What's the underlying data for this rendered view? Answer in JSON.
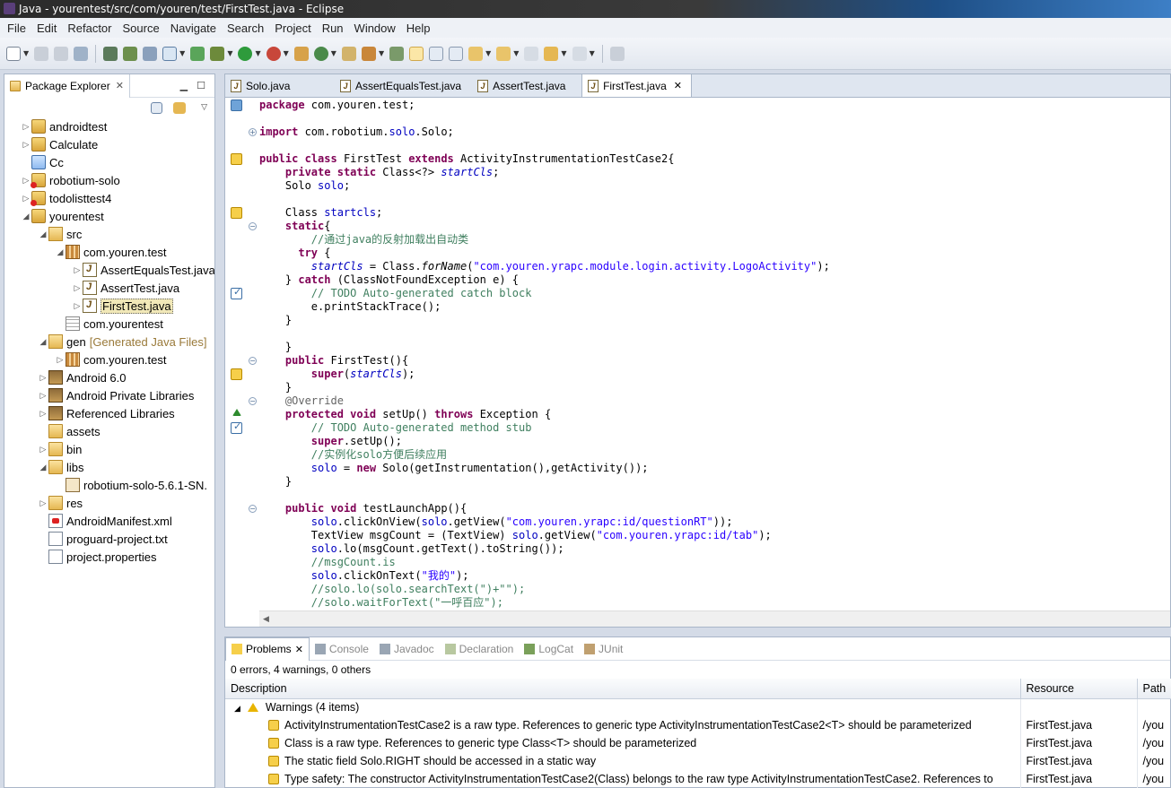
{
  "window": {
    "title": "Java - yourentest/src/com/youren/test/FirstTest.java - Eclipse"
  },
  "menu": [
    "File",
    "Edit",
    "Refactor",
    "Source",
    "Navigate",
    "Search",
    "Project",
    "Run",
    "Window",
    "Help"
  ],
  "package_explorer": {
    "tab_label": "Package Explorer",
    "items": [
      {
        "label": "androidtest",
        "suffix": "",
        "indent": 0,
        "arrow": "right",
        "icon": "project-icon"
      },
      {
        "label": "Calculate",
        "suffix": "",
        "indent": 0,
        "arrow": "right",
        "icon": "project-icon"
      },
      {
        "label": "Cc",
        "suffix": "",
        "indent": 0,
        "arrow": "",
        "icon": "folder-project-icon"
      },
      {
        "label": "robotium-solo",
        "suffix": "",
        "indent": 0,
        "arrow": "right",
        "icon": "project-error-icon"
      },
      {
        "label": "todolisttest4",
        "suffix": "",
        "indent": 0,
        "arrow": "right",
        "icon": "project-error-icon"
      },
      {
        "label": "yourentest",
        "suffix": "",
        "indent": 0,
        "arrow": "down",
        "icon": "project-icon"
      },
      {
        "label": "src",
        "suffix": "",
        "indent": 1,
        "arrow": "down",
        "icon": "source-folder-icon"
      },
      {
        "label": "com.youren.test",
        "suffix": "",
        "indent": 2,
        "arrow": "down",
        "icon": "package-icon"
      },
      {
        "label": "AssertEqualsTest.java",
        "suffix": "",
        "indent": 3,
        "arrow": "right",
        "icon": "java-file-icon"
      },
      {
        "label": "AssertTest.java",
        "suffix": "",
        "indent": 3,
        "arrow": "right",
        "icon": "java-file-icon"
      },
      {
        "label": "FirstTest.java",
        "suffix": "",
        "indent": 3,
        "arrow": "right",
        "icon": "java-file-icon",
        "selected": true
      },
      {
        "label": "com.yourentest",
        "suffix": "",
        "indent": 2,
        "arrow": "",
        "icon": "empty-package-icon"
      },
      {
        "label": "gen",
        "suffix": "[Generated Java Files]",
        "indent": 1,
        "arrow": "down",
        "icon": "source-folder-icon"
      },
      {
        "label": "com.youren.test",
        "suffix": "",
        "indent": 2,
        "arrow": "right",
        "icon": "package-icon"
      },
      {
        "label": "Android 6.0",
        "suffix": "",
        "indent": 1,
        "arrow": "right",
        "icon": "library-icon"
      },
      {
        "label": "Android Private Libraries",
        "suffix": "",
        "indent": 1,
        "arrow": "right",
        "icon": "library-icon"
      },
      {
        "label": "Referenced Libraries",
        "suffix": "",
        "indent": 1,
        "arrow": "right",
        "icon": "library-icon"
      },
      {
        "label": "assets",
        "suffix": "",
        "indent": 1,
        "arrow": "",
        "icon": "folder-icon"
      },
      {
        "label": "bin",
        "suffix": "",
        "indent": 1,
        "arrow": "right",
        "icon": "folder-icon"
      },
      {
        "label": "libs",
        "suffix": "",
        "indent": 1,
        "arrow": "down",
        "icon": "folder-icon"
      },
      {
        "label": "robotium-solo-5.6.1-SN.",
        "suffix": "",
        "indent": 2,
        "arrow": "",
        "icon": "jar-icon"
      },
      {
        "label": "res",
        "suffix": "",
        "indent": 1,
        "arrow": "right",
        "icon": "folder-icon"
      },
      {
        "label": "AndroidManifest.xml",
        "suffix": "",
        "indent": 1,
        "arrow": "",
        "icon": "xml-file-icon"
      },
      {
        "label": "proguard-project.txt",
        "suffix": "",
        "indent": 1,
        "arrow": "",
        "icon": "text-file-icon"
      },
      {
        "label": "project.properties",
        "suffix": "",
        "indent": 1,
        "arrow": "",
        "icon": "text-file-icon"
      }
    ]
  },
  "editor": {
    "tabs": [
      {
        "label": "Solo.java",
        "active": false
      },
      {
        "label": "AssertEqualsTest.java",
        "active": false
      },
      {
        "label": "AssertTest.java",
        "active": false
      },
      {
        "label": "FirstTest.java",
        "active": true
      }
    ],
    "lines": [
      "package com.youren.test;",
      "",
      "import com.robotium.solo.Solo;",
      "",
      "public class FirstTest extends ActivityInstrumentationTestCase2{",
      "    private static Class<?> startCls;",
      "    Solo solo;",
      "",
      "    Class startcls;",
      "    static{",
      "        //通过java的反射加载出自动类",
      "      try {",
      "        startCls = Class.forName(\"com.youren.yrapc.module.login.activity.LogoActivity\");",
      "    } catch (ClassNotFoundException e) {",
      "        // TODO Auto-generated catch block",
      "        e.printStackTrace();",
      "    }",
      "",
      "    }",
      "    public FirstTest(){",
      "        super(startCls);",
      "    }",
      "    @Override",
      "    protected void setUp() throws Exception {",
      "        // TODO Auto-generated method stub",
      "        super.setUp();",
      "        //实例化solo方便后续应用",
      "        solo = new Solo(getInstrumentation(),getActivity());",
      "    }",
      "",
      "    public void testLaunchApp(){",
      "        solo.clickOnView(solo.getView(\"com.youren.yrapc:id/questionRT\"));",
      "        TextView msgCount = (TextView) solo.getView(\"com.youren.yrapc:id/tab\");",
      "        solo.lo(msgCount.getText().toString());",
      "        //msgCount.is",
      "        solo.clickOnText(\"我的\");",
      "        //solo.lo(solo.searchText(\")+\"\");",
      "        //solo.waitForText(\"一呼百应\");"
    ]
  },
  "problems": {
    "tabs": [
      {
        "label": "Problems",
        "active": true
      },
      {
        "label": "Console",
        "active": false
      },
      {
        "label": "Javadoc",
        "active": false
      },
      {
        "label": "Declaration",
        "active": false
      },
      {
        "label": "LogCat",
        "active": false
      },
      {
        "label": "JUnit",
        "active": false
      }
    ],
    "summary": "0 errors, 4 warnings, 0 others",
    "columns": [
      "Description",
      "Resource",
      "Path"
    ],
    "group_label": "Warnings (4 items)",
    "rows": [
      {
        "description": "ActivityInstrumentationTestCase2 is a raw type. References to generic type ActivityInstrumentationTestCase2<T> should be parameterized",
        "resource": "FirstTest.java",
        "path": "/you"
      },
      {
        "description": "Class is a raw type. References to generic type Class<T> should be parameterized",
        "resource": "FirstTest.java",
        "path": "/you"
      },
      {
        "description": "The static field Solo.RIGHT should be accessed in a static way",
        "resource": "FirstTest.java",
        "path": "/you"
      },
      {
        "description": "Type safety: The constructor ActivityInstrumentationTestCase2(Class) belongs to the raw type ActivityInstrumentationTestCase2. References to",
        "resource": "FirstTest.java",
        "path": "/you"
      }
    ]
  }
}
